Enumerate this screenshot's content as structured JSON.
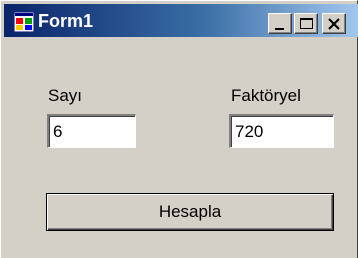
{
  "window": {
    "title": "Form1",
    "icon": "form-icon",
    "caption_buttons": {
      "minimize": "minimize-icon",
      "maximize": "maximize-icon",
      "close": "close-icon"
    },
    "colors": {
      "titlebar_start": "#0a246a",
      "titlebar_end": "#a6caf0",
      "face": "#d4d0c8"
    }
  },
  "form": {
    "sayi_label": "Sayı",
    "sayi_value": "6",
    "faktoryel_label": "Faktöryel",
    "faktoryel_value": "720",
    "calculate_button": "Hesapla"
  }
}
